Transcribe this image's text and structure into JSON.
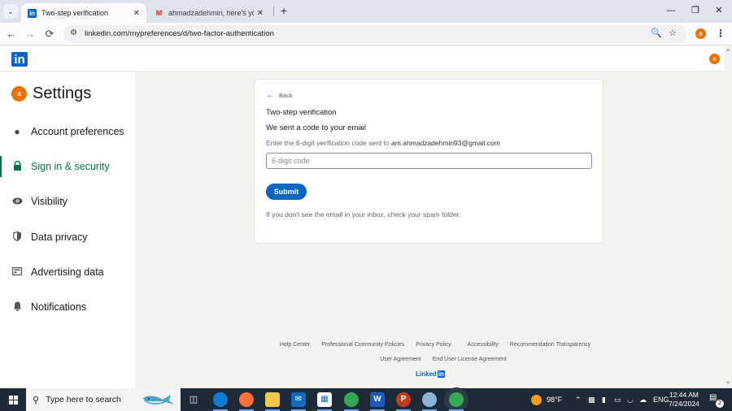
{
  "browser": {
    "tabs": [
      {
        "title": "Two-step verification",
        "favicon": "linkedin-icon",
        "active": true
      },
      {
        "title": "ahmadzadehmiri, here's your PI",
        "favicon": "gmail-icon",
        "active": false
      }
    ],
    "address": "linkedin.com/mypreferences/d/two-factor-authentication",
    "profile_initial": "a",
    "icons": {
      "back": "←",
      "forward": "→",
      "reload": "⟳",
      "tune": "⚙",
      "zoom": "🔍",
      "bookmark": "☆",
      "menu": "⋮",
      "minimize": "—",
      "restore": "❐",
      "close": "✕",
      "new_tab": "+",
      "tab_close": "✕",
      "tab_list": "⌄"
    }
  },
  "header": {
    "logo": "in",
    "avatar_initial": "a"
  },
  "sidebar": {
    "avatar_initial": "a",
    "title": "Settings",
    "items": [
      {
        "label": "Account preferences",
        "icon": "person-icon",
        "glyph": "👤",
        "active": false
      },
      {
        "label": "Sign in & security",
        "icon": "lock-icon",
        "glyph": "🔒",
        "active": true
      },
      {
        "label": "Visibility",
        "icon": "eye-icon",
        "glyph": "👁",
        "active": false
      },
      {
        "label": "Data privacy",
        "icon": "shield-icon",
        "glyph": "◐",
        "active": false
      },
      {
        "label": "Advertising data",
        "icon": "newspaper-icon",
        "glyph": "▤",
        "active": false
      },
      {
        "label": "Notifications",
        "icon": "bell-icon",
        "glyph": "🔔",
        "active": false
      }
    ]
  },
  "card": {
    "back_label": "Back",
    "title": "Two-step verification",
    "subtitle": "We sent a code to your email",
    "description": "Enter the 6-digit verification code sent to",
    "email": "am.ahmadzadehmiri93@gmail.com",
    "code_input": {
      "value": "",
      "placeholder": "6-digit code"
    },
    "submit_label": "Submit",
    "hint": "If you don't see the email in your inbox, check your spam folder."
  },
  "footer": {
    "row1": [
      "Help Center",
      "Professional Community Policies",
      "Privacy Policy",
      "Accessibility",
      "Recommendation Transparency"
    ],
    "row2": [
      "User Agreement",
      "End User License Agreement"
    ],
    "brand_text": "Linked",
    "brand_box": "in"
  },
  "taskbar": {
    "search_placeholder": "Type here to search",
    "weather": "98°F",
    "language": "ENG",
    "time": "12:44 AM",
    "date": "7/24/2024",
    "notification_count": "2",
    "colors": {
      "bg": "#1f2a38",
      "edge": "#0078d7",
      "firefox": "#ff7139",
      "files": "#f2c94c",
      "mail": "#0f6cbd",
      "store": "#ffffff",
      "chrome": "#34a853",
      "word": "#185abd",
      "powerpoint": "#c43e1c"
    }
  },
  "colors": {
    "linkedin_blue": "#0a66c2",
    "active_green": "#057642",
    "avatar_orange": "#e8710a",
    "page_bg": "#f3f2ef"
  }
}
